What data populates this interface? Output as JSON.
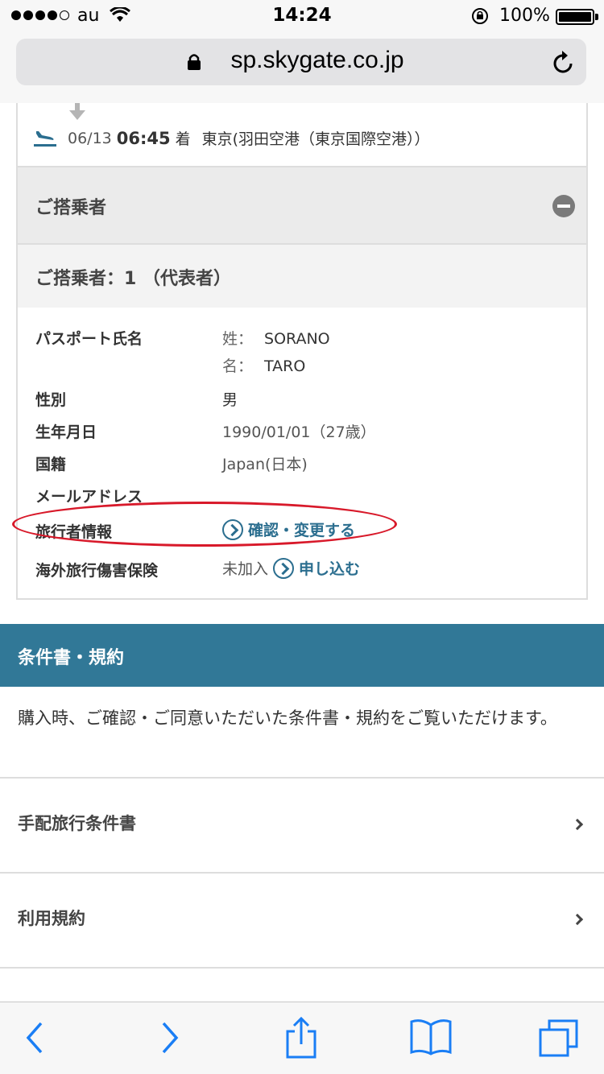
{
  "status_bar": {
    "carrier": "au",
    "time": "14:24",
    "battery": "100%",
    "battery_level": 1.0
  },
  "browser": {
    "url": "sp.skygate.co.jp"
  },
  "flight": {
    "date": "06/13",
    "time": "06:45",
    "status": "着",
    "airport": "東京(羽田空港（東京国際空港））"
  },
  "passengers": {
    "section_title": "ご搭乗者",
    "passenger_title": "ご搭乗者：1 （代表者）",
    "passport_name_label": "パスポート氏名",
    "surname_key": "姓：",
    "surname": "SORANO",
    "given_key": "名：",
    "given_name": "TARO",
    "gender_label": "性別",
    "gender": "男",
    "birthday_label": "生年月日",
    "birthday": "1990/01/01（27歳）",
    "nationality_label": "国籍",
    "nationality": "Japan(日本)",
    "email_label": "メールアドレス",
    "email": "",
    "traveler_info_label": "旅行者情報",
    "traveler_info_link": "確認・変更する",
    "insurance_label": "海外旅行傷害保険",
    "insurance_status": "未加入",
    "insurance_link": "申し込む"
  },
  "terms": {
    "section_title": "条件書・規約",
    "description": "購入時、ご確認・ご同意いただいた条件書・規約をご覧いただけます。",
    "items": [
      {
        "label": "手配旅行条件書"
      },
      {
        "label": "利用規約"
      }
    ]
  },
  "colors": {
    "accent": "#317897",
    "link": "#2b6e8f",
    "annotation": "#d8192a",
    "ios_blue": "#1a7ef5"
  },
  "icons": [
    "back-icon",
    "forward-icon",
    "share-icon",
    "bookmarks-icon",
    "tabs-icon",
    "reload-icon",
    "lock-icon",
    "arrival-plane-icon",
    "minus-circle-icon",
    "chevron-right-icon"
  ]
}
